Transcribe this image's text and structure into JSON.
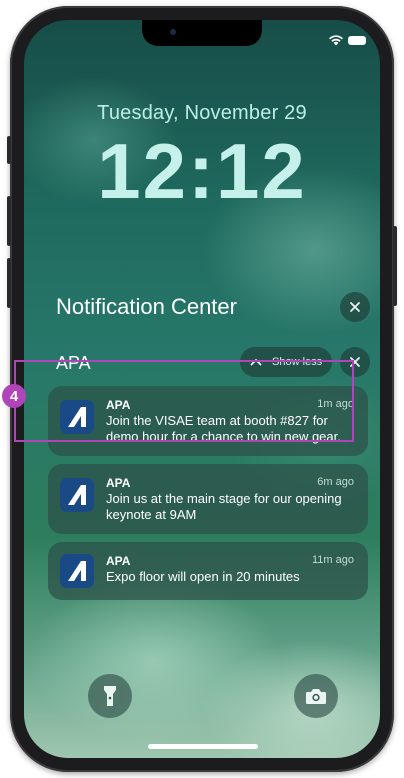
{
  "lock_screen": {
    "date": "Tuesday, November 29",
    "time": "12:12"
  },
  "notification_center": {
    "title": "Notification Center",
    "group": {
      "app_name": "APA",
      "show_less_label": "Show less"
    },
    "notifications": [
      {
        "app": "APA",
        "time": "1m ago",
        "body": "Join the VISAE team at booth #827 for demo hour for a chance to win new gear."
      },
      {
        "app": "APA",
        "time": "6m ago",
        "body": "Join us at the main stage for our opening keynote at 9AM"
      },
      {
        "app": "APA",
        "time": "11m ago",
        "body": "Expo floor will open in 20 minutes"
      }
    ]
  },
  "annotation": {
    "step": "4",
    "color": "#b144b9"
  },
  "icons": {
    "status": [
      "wifi-icon",
      "battery-icon"
    ],
    "bottom": [
      "flashlight-icon",
      "camera-icon"
    ],
    "close": "close-icon",
    "chevron": "chevron-up-icon",
    "app": "apa-logo-icon"
  }
}
